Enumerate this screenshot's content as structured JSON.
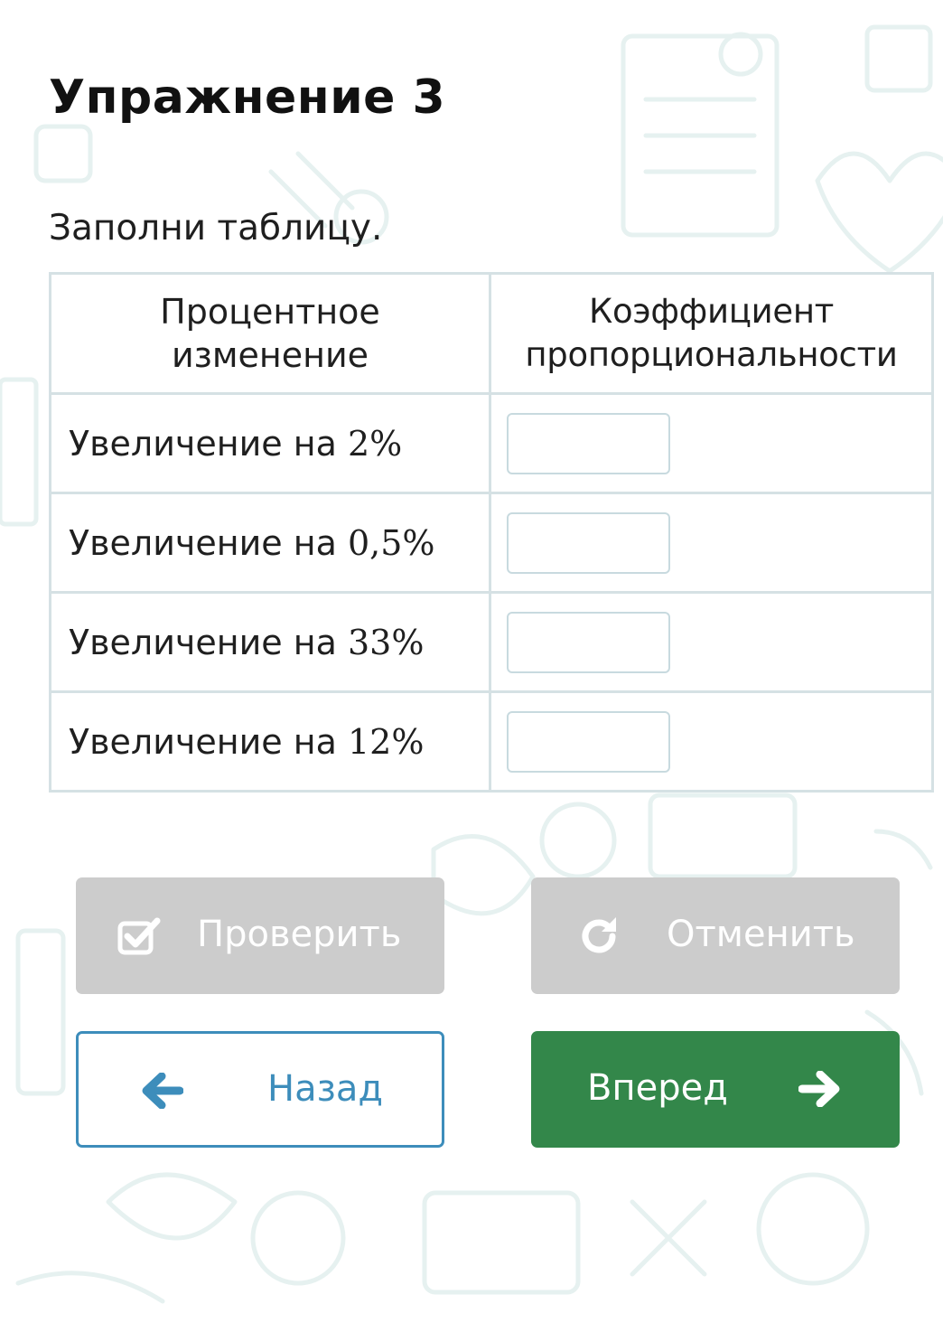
{
  "exercise": {
    "title": "Упражнение 3",
    "instruction": "Заполни таблицу."
  },
  "table": {
    "headers": [
      "Процентное\nизменение",
      "Коэффициент\nпропорциональности"
    ],
    "rows": [
      {
        "label_prefix": "Увеличение на ",
        "value": "2%",
        "answer": ""
      },
      {
        "label_prefix": "Увеличение на ",
        "value": "0,5%",
        "answer": ""
      },
      {
        "label_prefix": "Увеличение на ",
        "value": "33%",
        "answer": ""
      },
      {
        "label_prefix": "Увеличение на ",
        "value": "12%",
        "answer": ""
      }
    ]
  },
  "buttons": {
    "check": {
      "label": "Проверить",
      "icon": "checkbox-check-icon",
      "state": "disabled"
    },
    "reset": {
      "label": "Отменить",
      "icon": "redo-icon",
      "state": "disabled"
    },
    "back": {
      "label": "Назад",
      "icon": "arrow-left-icon"
    },
    "next": {
      "label": "Вперед",
      "icon": "arrow-right-icon"
    }
  },
  "colors": {
    "disabled_button": "#cccccc",
    "back_button_accent": "#3d8dbb",
    "next_button": "#33874a",
    "table_border": "#d5e1e4"
  }
}
